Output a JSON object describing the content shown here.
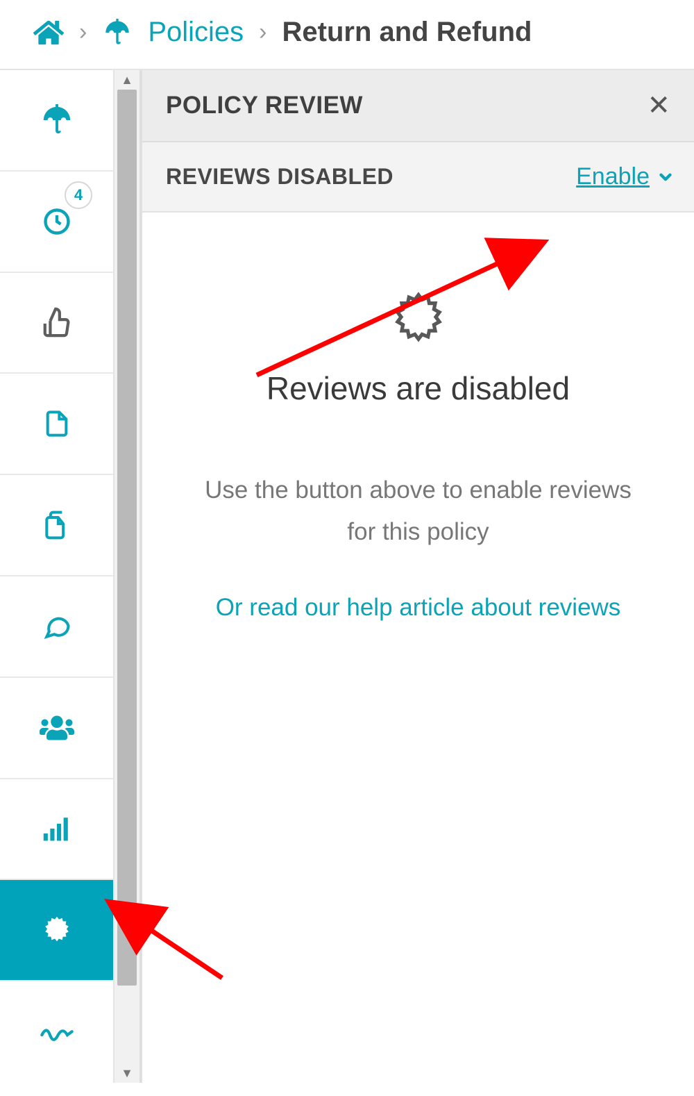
{
  "breadcrumb": {
    "policies_label": "Policies",
    "current_label": "Return and Refund"
  },
  "sidebar": {
    "items": [
      {
        "name": "policies",
        "icon": "umbrella"
      },
      {
        "name": "history",
        "icon": "clock",
        "badge": "4"
      },
      {
        "name": "approvals",
        "icon": "thumbs-up"
      },
      {
        "name": "document",
        "icon": "file"
      },
      {
        "name": "copies",
        "icon": "files"
      },
      {
        "name": "comments",
        "icon": "chat"
      },
      {
        "name": "users",
        "icon": "people"
      },
      {
        "name": "stats",
        "icon": "bars"
      },
      {
        "name": "review",
        "icon": "seal",
        "active": true
      },
      {
        "name": "signature",
        "icon": "squiggle"
      }
    ]
  },
  "panel": {
    "title": "POLICY REVIEW",
    "sub_label": "REVIEWS DISABLED",
    "enable_label": "Enable",
    "disabled_title": "Reviews are disabled",
    "disabled_sub": "Use the button above to enable reviews for this policy",
    "help_link": "Or read our help article about reviews"
  }
}
